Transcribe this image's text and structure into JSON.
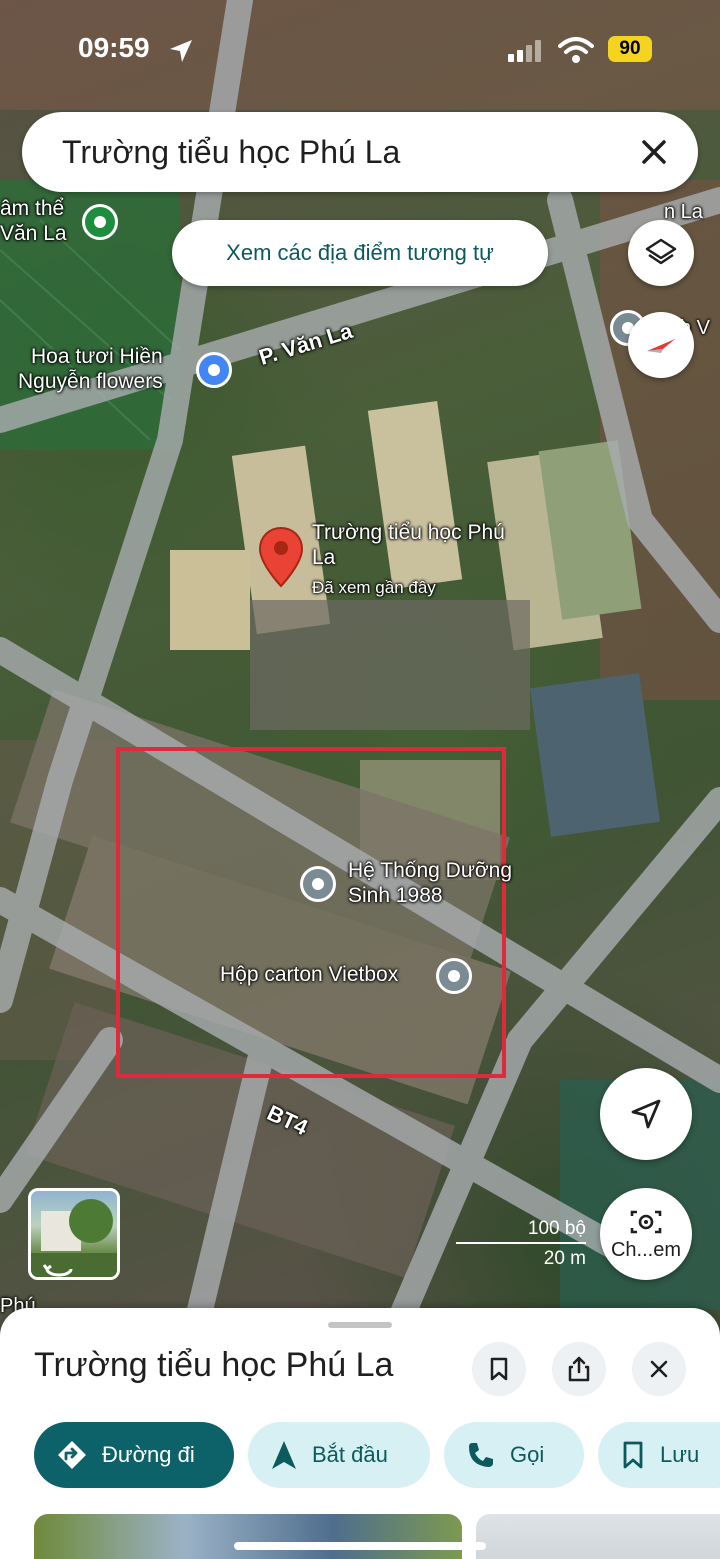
{
  "status_bar": {
    "time": "09:59",
    "battery": "90"
  },
  "search": {
    "query": "Trường tiểu học Phú La"
  },
  "map": {
    "similar_places_button": "Xem các địa điểm tương tự",
    "labels": {
      "top_left_partial": "âm thể\nVăn La",
      "flower_shop": "Hoa tươi Hiền\nNguyễn flowers",
      "street_van_la": "P. Văn La",
      "school_name": "Trường tiểu học Phú\nLa",
      "school_sub": "Đã xem gần đây",
      "duong_sinh": "Hệ Thống Dưỡng\nSinh 1988",
      "vietbox": "Hộp carton Vietbox",
      "street_bt4": "BT4",
      "right_partial_top": "n La",
      "right_partial_mid": "h V",
      "left_partial_bottom": "Phú"
    },
    "scale": {
      "feet": "100 bộ",
      "meters": "20 m"
    },
    "camera_button_label": "Ch...em"
  },
  "place_sheet": {
    "title": "Trường tiểu học Phú La",
    "actions": {
      "directions": "Đường đi",
      "start": "Bắt đầu",
      "call": "Gọi",
      "save": "Lưu"
    }
  },
  "colors": {
    "accent_teal": "#0d6168",
    "chip_bg": "#d7f0f3",
    "highlight_box": "#e0293a",
    "pin_red": "#ea4335"
  }
}
